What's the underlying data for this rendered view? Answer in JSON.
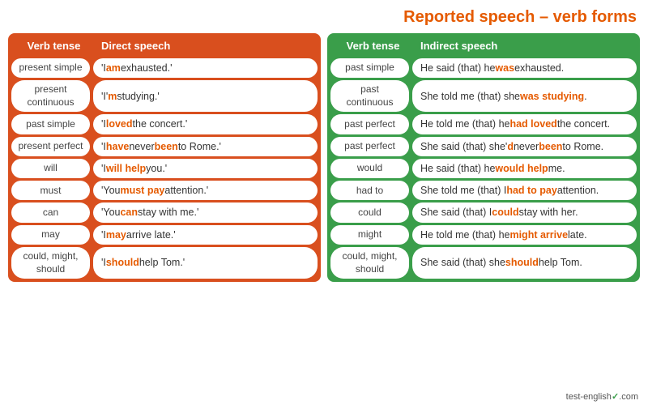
{
  "title": "Reported speech – verb forms",
  "left_table": {
    "headers": [
      "Verb tense",
      "Direct speech"
    ],
    "rows": [
      {
        "verb": "present simple",
        "speech_html": "'I <span class=\"red\">am</span> exhausted.'"
      },
      {
        "verb": "present continuous",
        "speech_html": "'I'<span class=\"red\">m</span> studying.'"
      },
      {
        "verb": "past simple",
        "speech_html": "'I <span class=\"red\">loved</span> the concert.'"
      },
      {
        "verb": "present perfect",
        "speech_html": "'I <span class=\"red\">have</span> never <span class=\"red\">been</span> to Rome.'"
      },
      {
        "verb": "will",
        "speech_html": "'I <span class=\"red\">will help</span> you.'"
      },
      {
        "verb": "must",
        "speech_html": "'You <span class=\"red\">must pay</span> attention.'"
      },
      {
        "verb": "can",
        "speech_html": "'You <span class=\"red\">can</span> stay with me.'"
      },
      {
        "verb": "may",
        "speech_html": "'I <span class=\"red\">may</span> arrive late.'"
      },
      {
        "verb": "could, might, should",
        "speech_html": "'I <span class=\"red\">should</span> help Tom.'"
      }
    ]
  },
  "right_table": {
    "headers": [
      "Verb tense",
      "Indirect speech"
    ],
    "rows": [
      {
        "verb": "past simple",
        "speech_html": "He said (that) he <span class=\"red\">was</span> exhausted."
      },
      {
        "verb": "past continuous",
        "speech_html": "She told me (that) she <span class=\"red\">was studying</span>."
      },
      {
        "verb": "past perfect",
        "speech_html": "He told me (that) he <span class=\"red\">had loved</span> the concert."
      },
      {
        "verb": "past perfect",
        "speech_html": "She said (that) she'<span class=\"red\">d</span> never <span class=\"red\">been</span> to Rome."
      },
      {
        "verb": "would",
        "speech_html": "He said (that) he <span class=\"red\">would help</span> me."
      },
      {
        "verb": "had to",
        "speech_html": "She told me (that) I <span class=\"red\">had to pay</span> attention."
      },
      {
        "verb": "could",
        "speech_html": "She said (that) I <span class=\"red\">could</span> stay with her."
      },
      {
        "verb": "might",
        "speech_html": "He told me (that) he <span class=\"red\">might arrive</span> late."
      },
      {
        "verb": "could, might, should",
        "speech_html": "She said (that) she <span class=\"red\">should</span> help Tom."
      }
    ]
  },
  "footer": "test-english",
  "footer_tld": ".com"
}
